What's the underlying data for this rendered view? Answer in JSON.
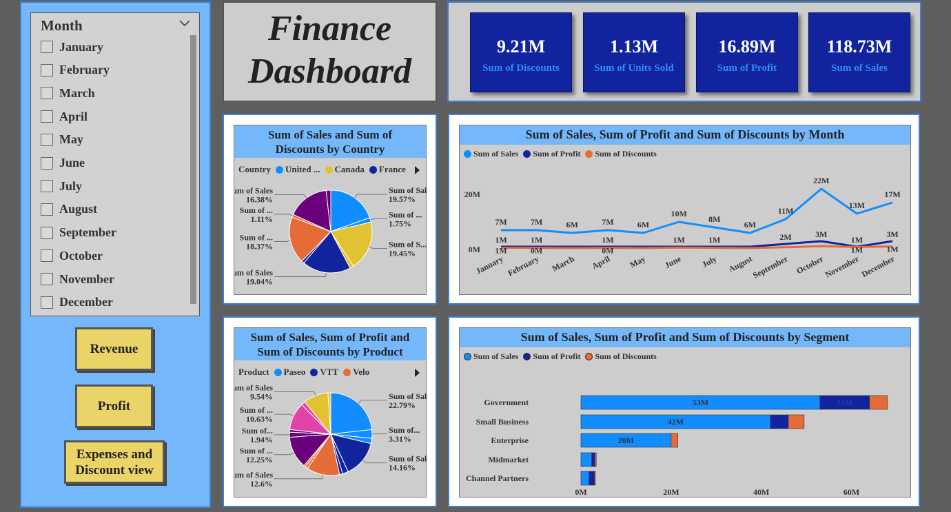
{
  "slicer": {
    "title": "Month",
    "months": [
      "January",
      "February",
      "March",
      "April",
      "May",
      "June",
      "July",
      "August",
      "September",
      "October",
      "November",
      "December"
    ]
  },
  "nav": {
    "revenue": "Revenue",
    "profit": "Profit",
    "expenses_l1": "Expenses and",
    "expenses_l2": "Discount view"
  },
  "header": {
    "title_l1": "Finance",
    "title_l2": "Dashboard"
  },
  "kpis": [
    {
      "value": "9.21M",
      "label": "Sum of Discounts"
    },
    {
      "value": "1.13M",
      "label": "Sum of Units Sold"
    },
    {
      "value": "16.89M",
      "label": "Sum of Profit"
    },
    {
      "value": "118.73M",
      "label": "Sum of  Sales"
    }
  ],
  "colors": {
    "sales": "#118dff",
    "profit": "#12239e",
    "discounts": "#e66c37",
    "canada": "#e1c233",
    "purple": "#6b007b",
    "magenta": "#e044a7",
    "panel_title": "#74b8fb",
    "button": "#ead468"
  },
  "chart_data": [
    {
      "type": "pie",
      "title_l1": "Sum of Sales and Sum of",
      "title_l2": "Discounts by Country",
      "legend_title": "Country",
      "legend": [
        "United ...",
        "Canada",
        "France"
      ],
      "slices": [
        {
          "label": "Sum of Sales",
          "pct": 19.57,
          "pct_text": "19.57%",
          "color": "#118dff"
        },
        {
          "label": "Sum of ...",
          "pct": 1.75,
          "pct_text": "1.75%",
          "color": "#118dff"
        },
        {
          "label": "Sum of S...",
          "pct": 19.45,
          "pct_text": "19.45%",
          "color": "#e1c233"
        },
        {
          "label": "",
          "pct": 1.5,
          "pct_text": "",
          "color": "#e1c233"
        },
        {
          "label": "Sum of Sales",
          "pct": 19.04,
          "pct_text": "19.04%",
          "color": "#12239e"
        },
        {
          "label": "",
          "pct": 1.0,
          "pct_text": "",
          "color": "#12239e"
        },
        {
          "label": "Sum of ...",
          "pct": 18.37,
          "pct_text": "18.37%",
          "color": "#e66c37"
        },
        {
          "label": "Sum of ...",
          "pct": 1.11,
          "pct_text": "1.11%",
          "color": "#e66c37"
        },
        {
          "label": "Sum of Sales",
          "pct": 16.38,
          "pct_text": "16.38%",
          "color": "#6b007b"
        },
        {
          "label": "",
          "pct": 1.83,
          "pct_text": "",
          "color": "#6b007b"
        }
      ]
    },
    {
      "type": "line",
      "title": "Sum of Sales, Sum of Profit and Sum of Discounts by Month",
      "legend": [
        "Sum of  Sales",
        "Sum of Profit",
        "Sum of Discounts"
      ],
      "categories": [
        "January",
        "February",
        "March",
        "April",
        "May",
        "June",
        "July",
        "August",
        "September",
        "October",
        "November",
        "December"
      ],
      "y_ticks": [
        "0M",
        "20M"
      ],
      "ylim": [
        0,
        25
      ],
      "series": [
        {
          "name": "Sum of  Sales",
          "values": [
            7,
            7,
            6,
            7,
            6,
            10,
            8,
            6,
            11,
            22,
            13,
            17
          ],
          "labels": [
            "7M",
            "7M",
            "6M",
            "7M",
            "6M",
            "10M",
            "8M",
            "6M",
            "11M",
            "22M",
            "13M",
            "17M"
          ]
        },
        {
          "name": "Sum of Profit",
          "values": [
            1,
            1,
            1,
            1,
            1,
            1,
            1,
            1,
            2,
            3,
            1,
            3
          ],
          "labels": [
            "1M",
            "1M",
            "",
            "1M",
            "",
            "1M",
            "1M",
            "",
            "2M",
            "3M",
            "1M",
            "3M"
          ]
        },
        {
          "name": "Sum of Discounts",
          "values": [
            0.6,
            0.6,
            0.5,
            0.6,
            0.5,
            0.7,
            0.6,
            0.5,
            0.8,
            1.2,
            0.9,
            1.1
          ],
          "labels": [
            "1M",
            "0M",
            "",
            "0M",
            "",
            "",
            "",
            "",
            "",
            "",
            "1M",
            "1M"
          ]
        }
      ]
    },
    {
      "type": "pie",
      "title_l1": "Sum of Sales, Sum of Profit and",
      "title_l2": "Sum of Discounts by Product",
      "legend_title": "Product",
      "legend": [
        "Paseo",
        "VTT",
        "Velo"
      ],
      "slices": [
        {
          "label": "Sum of Sales",
          "pct": 22.79,
          "pct_text": "22.79%",
          "color": "#118dff"
        },
        {
          "label": "Sum of...",
          "pct": 3.31,
          "pct_text": "3.31%",
          "color": "#118dff"
        },
        {
          "label": "",
          "pct": 2.0,
          "pct_text": "",
          "color": "#118dff"
        },
        {
          "label": "Sum of Sales",
          "pct": 14.16,
          "pct_text": "14.16%",
          "color": "#12239e"
        },
        {
          "label": "",
          "pct": 2.2,
          "pct_text": "",
          "color": "#12239e"
        },
        {
          "label": "",
          "pct": 1.2,
          "pct_text": "",
          "color": "#12239e"
        },
        {
          "label": "Sum of Sales",
          "pct": 12.6,
          "pct_text": "12.6%",
          "color": "#e66c37"
        },
        {
          "label": "",
          "pct": 1.0,
          "pct_text": "",
          "color": "#e66c37"
        },
        {
          "label": "",
          "pct": 0.8,
          "pct_text": "",
          "color": "#e66c37"
        },
        {
          "label": "Sum of ...",
          "pct": 12.25,
          "pct_text": "12.25%",
          "color": "#6b007b"
        },
        {
          "label": "Sum of...",
          "pct": 1.94,
          "pct_text": "1.94%",
          "color": "#6b007b"
        },
        {
          "label": "",
          "pct": 1.0,
          "pct_text": "",
          "color": "#6b007b"
        },
        {
          "label": "Sum of ...",
          "pct": 10.63,
          "pct_text": "10.63%",
          "color": "#e044a7"
        },
        {
          "label": "",
          "pct": 1.5,
          "pct_text": "",
          "color": "#e044a7"
        },
        {
          "label": "Sum of Sales",
          "pct": 9.54,
          "pct_text": "9.54%",
          "color": "#e1c233"
        },
        {
          "label": "",
          "pct": 1.08,
          "pct_text": "",
          "color": "#e1c233"
        }
      ]
    },
    {
      "type": "bar",
      "orientation": "horizontal",
      "stacked": true,
      "title": "Sum of Sales, Sum of Profit and Sum of Discounts by Segment",
      "legend": [
        "Sum of  Sales",
        "Sum of Profit",
        "Sum of Discounts"
      ],
      "categories": [
        "Government",
        "Small Business",
        "Enterprise",
        "Midmarket",
        "Channel Partners"
      ],
      "x_ticks": [
        "0M",
        "20M",
        "40M",
        "60M"
      ],
      "xlim": [
        0,
        70
      ],
      "series": [
        {
          "name": "Sum of  Sales",
          "values": [
            53,
            42,
            20,
            2.4,
            1.8
          ],
          "labels": [
            "53M",
            "42M",
            "20M",
            "",
            ""
          ]
        },
        {
          "name": "Sum of Profit",
          "values": [
            11,
            4,
            0,
            0.7,
            1.2
          ],
          "labels": [
            "11M",
            "",
            "",
            "",
            ""
          ]
        },
        {
          "name": "Sum of Discounts",
          "values": [
            4,
            3.5,
            1.5,
            0.3,
            0.2
          ],
          "labels": [
            "",
            "",
            "",
            "",
            ""
          ]
        }
      ]
    }
  ]
}
